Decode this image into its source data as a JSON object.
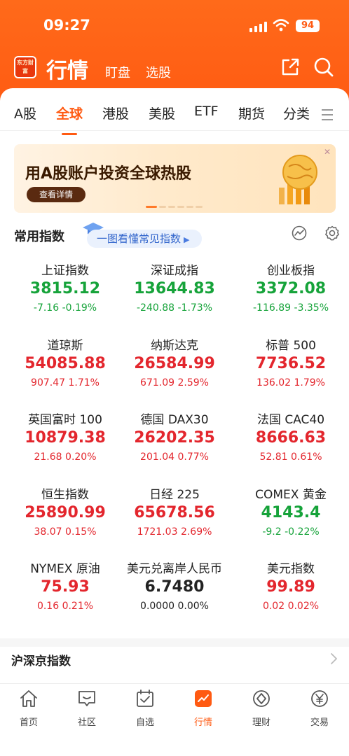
{
  "status": {
    "time": "09:27",
    "battery": "94"
  },
  "app": {
    "logo": "东方财富",
    "title": "行情",
    "link1": "盯盘",
    "link2": "选股"
  },
  "tabs": [
    {
      "label": "A股"
    },
    {
      "label": "全球"
    },
    {
      "label": "港股"
    },
    {
      "label": "美股"
    },
    {
      "label": "ETF"
    },
    {
      "label": "期货"
    },
    {
      "label": "分类"
    }
  ],
  "banner": {
    "title": "用A股账户投资全球热股",
    "button": "查看详情"
  },
  "common": {
    "title": "常用指数",
    "guide": "一图看懂常见指数"
  },
  "indices": [
    {
      "name": "上证指数",
      "price": "3815.12",
      "change": "-7.16",
      "pct": "-0.19%",
      "dir": "green"
    },
    {
      "name": "深证成指",
      "price": "13644.83",
      "change": "-240.88",
      "pct": "-1.73%",
      "dir": "green"
    },
    {
      "name": "创业板指",
      "price": "3372.08",
      "change": "-116.89",
      "pct": "-3.35%",
      "dir": "green"
    },
    {
      "name": "道琼斯",
      "price": "54085.88",
      "change": "907.47",
      "pct": "1.71%",
      "dir": "red"
    },
    {
      "name": "纳斯达克",
      "price": "26584.99",
      "change": "671.09",
      "pct": "2.59%",
      "dir": "red"
    },
    {
      "name": "标普 500",
      "price": "7736.52",
      "change": "136.02",
      "pct": "1.79%",
      "dir": "red"
    },
    {
      "name": "英国富时 100",
      "price": "10879.38",
      "change": "21.68",
      "pct": "0.20%",
      "dir": "red"
    },
    {
      "name": "德国 DAX30",
      "price": "26202.35",
      "change": "201.04",
      "pct": "0.77%",
      "dir": "red"
    },
    {
      "name": "法国 CAC40",
      "price": "8666.63",
      "change": "52.81",
      "pct": "0.61%",
      "dir": "red"
    },
    {
      "name": "恒生指数",
      "price": "25890.99",
      "change": "38.07",
      "pct": "0.15%",
      "dir": "red"
    },
    {
      "name": "日经 225",
      "price": "65678.56",
      "change": "1721.03",
      "pct": "2.69%",
      "dir": "red"
    },
    {
      "name": "COMEX 黄金",
      "price": "4143.4",
      "change": "-9.2",
      "pct": "-0.22%",
      "dir": "green"
    },
    {
      "name": "NYMEX 原油",
      "price": "75.93",
      "change": "0.16",
      "pct": "0.21%",
      "dir": "red"
    },
    {
      "name": "美元兑离岸人民币",
      "price": "6.7480",
      "change": "0.0000",
      "pct": "0.00%",
      "dir": "flat"
    },
    {
      "name": "美元指数",
      "price": "99.89",
      "change": "0.02",
      "pct": "0.02%",
      "dir": "red"
    }
  ],
  "section2": {
    "title": "沪深京指数"
  },
  "nav": [
    {
      "label": "首页",
      "icon": "home-icon"
    },
    {
      "label": "社区",
      "icon": "community-icon"
    },
    {
      "label": "自选",
      "icon": "watchlist-icon"
    },
    {
      "label": "行情",
      "icon": "market-icon"
    },
    {
      "label": "理财",
      "icon": "wealth-icon"
    },
    {
      "label": "交易",
      "icon": "trade-icon"
    }
  ],
  "colors": {
    "accent": "#ff5a12",
    "up": "#e3262d",
    "down": "#16a33a"
  }
}
